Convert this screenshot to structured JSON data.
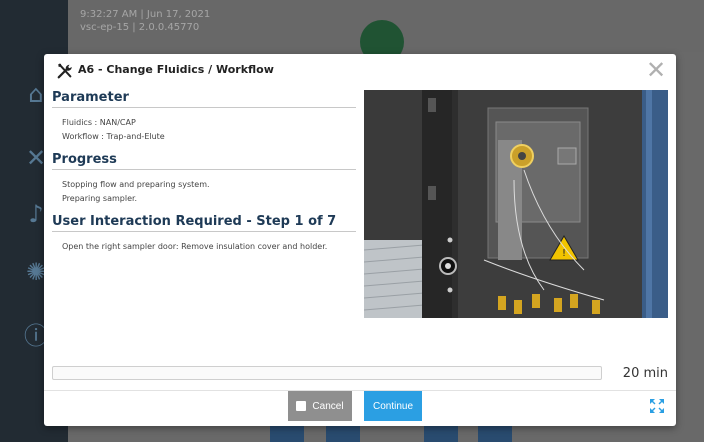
{
  "background": {
    "time": "9:32:27 AM | Jun 17, 2021",
    "device": "vsc-ep-15 | 2.0.0.45770"
  },
  "modal": {
    "title": "A6 - Change Fluidics / Workflow",
    "sections": {
      "parameter": {
        "title": "Parameter",
        "lines": [
          "Fluidics : NAN/CAP",
          "Workflow : Trap-and-Elute"
        ]
      },
      "progress": {
        "title": "Progress",
        "lines": [
          "Stopping flow and preparing system.",
          "Preparing sampler."
        ]
      },
      "interaction": {
        "title": "User Interaction Required - Step 1 of 7",
        "lines": [
          "Open the right sampler door: Remove insulation cover and holder."
        ]
      }
    },
    "progress_fraction": 0.0,
    "time_remaining": "20 min",
    "buttons": {
      "cancel": "Cancel",
      "continue": "Continue"
    }
  },
  "colors": {
    "accent": "#2b9fe3",
    "title": "#1e3a56",
    "cancel": "#8f8f8f"
  }
}
